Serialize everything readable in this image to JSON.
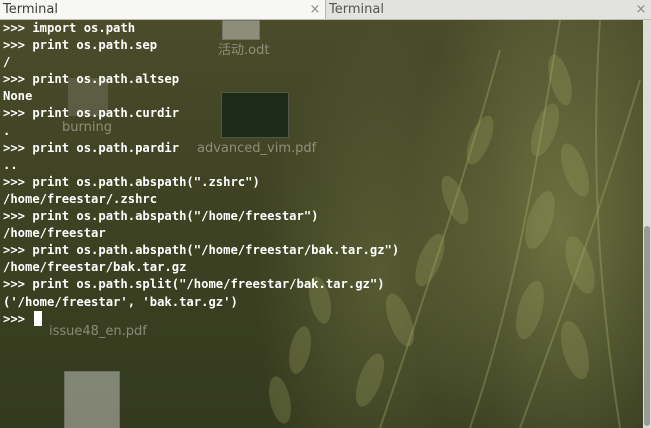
{
  "tabs": [
    {
      "label": "Terminal",
      "close": "×"
    },
    {
      "label": "Terminal",
      "close": "×"
    }
  ],
  "desktop_icons": {
    "file1": "活动.odt",
    "file2": "burning",
    "file3": "advanced_vim.pdf",
    "file4": "issue48_en.pdf"
  },
  "terminal": {
    "lines": [
      ">>> import os.path",
      ">>> print os.path.sep",
      "/",
      ">>> print os.path.altsep",
      "None",
      ">>> print os.path.curdir",
      ".",
      ">>> print os.path.pardir",
      "..",
      ">>> print os.path.abspath(\".zshrc\")",
      "/home/freestar/.zshrc",
      ">>> print os.path.abspath(\"/home/freestar\")",
      "/home/freestar",
      ">>> print os.path.abspath(\"/home/freestar/bak.tar.gz\")",
      "/home/freestar/bak.tar.gz",
      ">>> print os.path.split(\"/home/freestar/bak.tar.gz\")",
      "('/home/freestar', 'bak.tar.gz')"
    ],
    "prompt": ">>> "
  },
  "colors": {
    "text": "#ffffff",
    "tab_active": "#f7f7f5",
    "tab_inactive": "#e2e2de"
  }
}
